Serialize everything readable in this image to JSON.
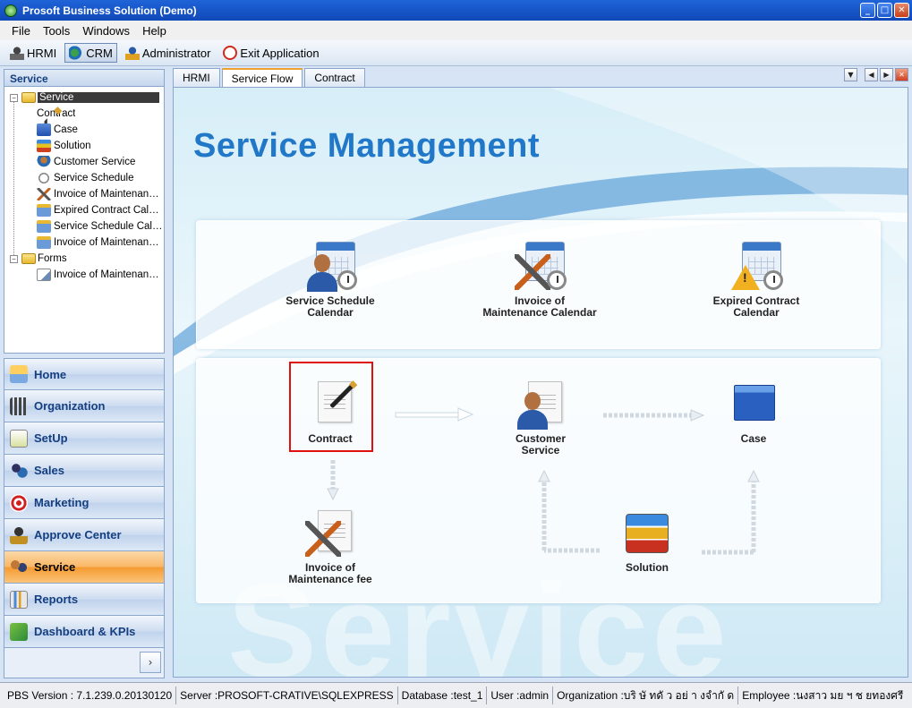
{
  "window": {
    "title": "Prosoft Business Solution (Demo)"
  },
  "menu": [
    "File",
    "Tools",
    "Windows",
    "Help"
  ],
  "toolbar": {
    "hrmi": "HRMI",
    "crm": "CRM",
    "admin": "Administrator",
    "exit": "Exit Application"
  },
  "left_panel": {
    "header": "Service",
    "tree": {
      "service_folder": "Service",
      "service_items": [
        "Contract",
        "Case",
        "Solution",
        "Customer Service",
        "Service Schedule",
        "Invoice of Maintenan…",
        "Expired Contract Cal…",
        "Service Schedule Cal…",
        "Invoice of Maintenan…"
      ],
      "forms_folder": "Forms",
      "forms_items": [
        "Invoice of Maintenan…"
      ]
    },
    "nav": [
      "Home",
      "Organization",
      "SetUp",
      "Sales",
      "Marketing",
      "Approve Center",
      "Service",
      "Reports",
      "Dashboard & KPIs"
    ],
    "nav_active": "Service",
    "more": "›"
  },
  "tabs": [
    "HRMI",
    "Service Flow",
    "Contract"
  ],
  "tab_active": "Service Flow",
  "content": {
    "title": "Service Management",
    "watermark": "Service",
    "top_items": {
      "schedule": "Service Schedule\nCalendar",
      "invoice_cal": "Invoice of\nMaintenance Calendar",
      "expired": "Expired Contract\nCalendar"
    },
    "flow_items": {
      "contract": "Contract",
      "customer_service": "Customer\nService",
      "case": "Case",
      "invoice_fee": "Invoice of\nMaintenance fee",
      "solution": "Solution"
    }
  },
  "status": {
    "version": "PBS Version : 7.1.239.0.20130120",
    "server": "Server :PROSOFT-CRATIVE\\SQLEXPRESS",
    "database": "Database :test_1",
    "user": "User :admin",
    "organization": "Organization :บริ ษั ทดั ว อย่ า งจำกั ด",
    "employee": "Employee :นงสาว มย ฯ ช ยทองศรี"
  }
}
